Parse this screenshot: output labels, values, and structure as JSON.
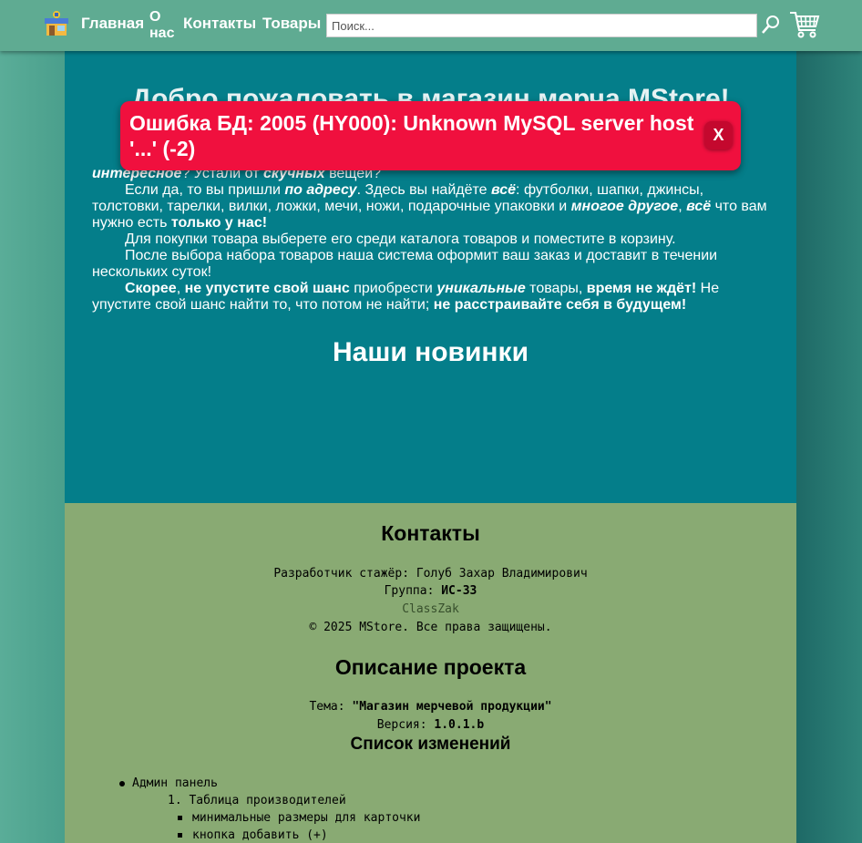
{
  "header": {
    "nav": {
      "home": "Главная",
      "about": "О нас",
      "contacts": "Контакты",
      "products": "Товары"
    },
    "search": {
      "placeholder": "Поиск..."
    },
    "icons": {
      "logo": "store-logo-icon",
      "search": "magnifier-icon",
      "cart": "cart-icon"
    }
  },
  "main": {
    "welcome_title": "Добро пожаловать в магазин мерча MStore!",
    "intro": {
      "p1_bold_italic": "интересное",
      "p1_a": "? Устали от ",
      "p1_bold_italic2": "скучных",
      "p1_b": " вещей?",
      "p2_a": "Если да, то вы пришли ",
      "p2_bi": "по адресу",
      "p2_b": ". Здесь вы найдёте ",
      "p2_bi2": "всё",
      "p2_c": ": футболки, шапки, джинсы, толстовки, тарелки, вилки, ложки, мечи, ножи, подарочные упаковки и ",
      "p2_bi3": "многое другое",
      "p2_d": ", ",
      "p2_bi4": "всё",
      "p2_e": " что вам нужно есть ",
      "p2_b5": "только у нас!",
      "p3": "Для покупки товара выберете его среди каталога товаров и поместите в корзину.",
      "p4": "После выбора набора товаров наша система оформит ваш заказ и доставит в течении нескольких суток!",
      "p5_b1": "Скорее",
      "p5_a": ", ",
      "p5_b2": "не упустите свой шанс",
      "p5_c": " приобрести ",
      "p5_bi": "уникальные",
      "p5_d": " товары, ",
      "p5_b3": "время не ждёт!",
      "p5_e": " Не упустите свой шанс найти то, что потом не найти; ",
      "p5_b4": "не расстраивайте себя в будущем!"
    },
    "new_title": "Наши новинки"
  },
  "error_toast": {
    "message": "Ошибка БД: 2005 (HY000): Unknown MySQL server host '...' (-2)",
    "close_label": "X",
    "color": "#f0103e"
  },
  "footer": {
    "contacts_title": "Контакты",
    "developer": "Разработчик стажёр: Голуб Захар Владимирович",
    "group_label": "Группа: ",
    "group_value": "ИС-33",
    "github": "ClassZak",
    "copyright": "© 2025 MStore. Все права защищены.",
    "project_title": "Описание проекта",
    "theme_label": "Тема: ",
    "theme_value": "\"Магазин мерчевой продукции\"",
    "version_label": "Версия: ",
    "version_value": "1.0.1.b",
    "changes_title": "Список изменений",
    "changes": {
      "item1": "Админ панель",
      "sub1": "1. Таблица производителей",
      "sub1a": "минимальные размеры для карточки",
      "sub1b": "кнопка добавить (+)"
    }
  },
  "colors": {
    "header": "#5fab92",
    "main": "#047e8a",
    "footer": "#89aa73"
  }
}
